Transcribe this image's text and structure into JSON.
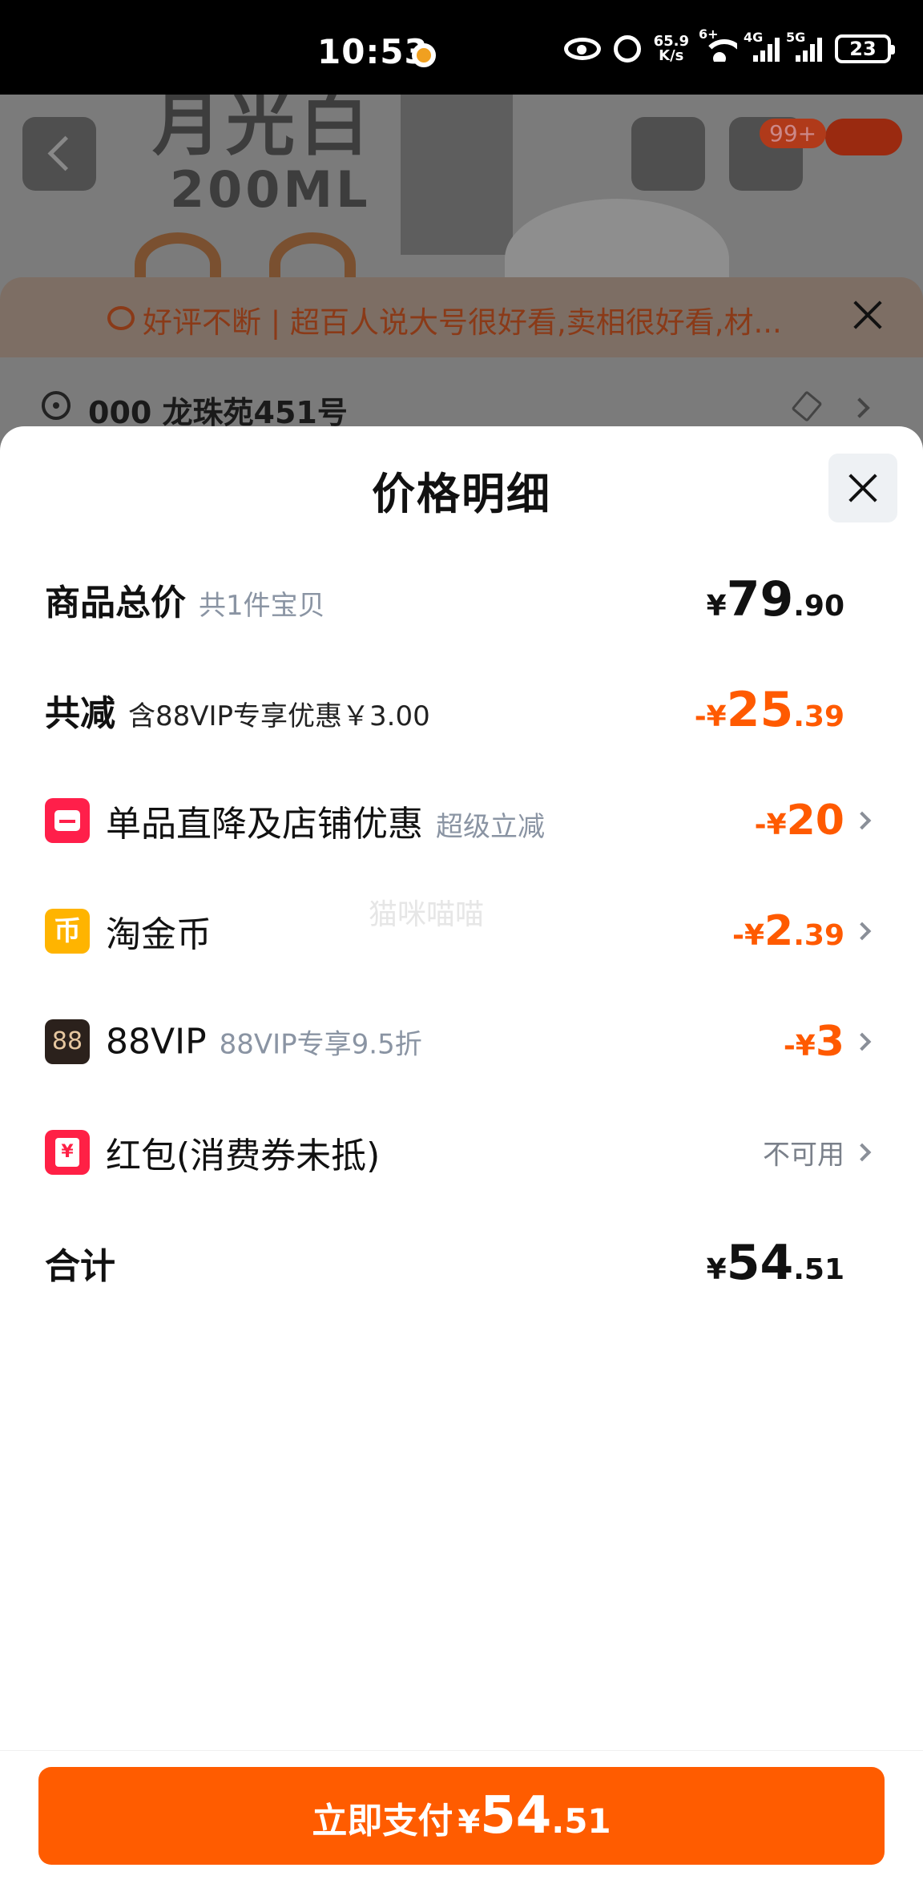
{
  "status_bar": {
    "time": "10:53",
    "net_speed": "65.9",
    "net_unit": "K/s",
    "wifi_badge": "6+",
    "sim1": "4G",
    "sim2": "5G",
    "battery": "23"
  },
  "background_page": {
    "product_line1": "月光白",
    "product_line2": "200ML",
    "cart_badge": "99+",
    "notice": "好评不断 | 超百人说大号很好看,卖相很好看,材...",
    "address": "000 龙珠苑451号"
  },
  "sheet": {
    "title": "价格明细",
    "rows": [
      {
        "label": "商品总价",
        "sub": "共1件宝贝",
        "currency": "¥",
        "int": "79",
        "dec": ".90"
      },
      {
        "label": "共减",
        "sub": "含88VIP专享优惠￥3.00",
        "prefix": "-¥",
        "int": "25",
        "dec": ".39"
      },
      {
        "label": "单品直降及店铺优惠",
        "sub": "超级立减",
        "prefix": "-¥",
        "int": "20",
        "dec": ""
      },
      {
        "label": "淘金币",
        "icon_char": "币",
        "prefix": "-¥",
        "int": "2",
        "dec": ".39"
      },
      {
        "label": "88VIP",
        "icon_char": "88",
        "sub": "88VIP专享9.5折",
        "prefix": "-¥",
        "int": "3",
        "dec": ""
      },
      {
        "label": "红包(消费券未抵)",
        "status": "不可用"
      },
      {
        "label": "合计",
        "currency": "¥",
        "int": "54",
        "dec": ".51"
      }
    ]
  },
  "watermark": "猫咪喵喵",
  "pay_button": {
    "label": "立即支付",
    "currency": "¥",
    "int": "54",
    "dec": ".51"
  },
  "colors": {
    "accent": "#ff5c00",
    "discount": "#ff5a00",
    "shop_icon": "#ff1f4a",
    "coin_icon": "#ffb400",
    "vip_icon": "#2b211c"
  },
  "icons": [
    "eye-icon",
    "alarm-icon",
    "wifi-icon",
    "signal-icon",
    "battery-icon",
    "back-icon",
    "share-icon",
    "cart-icon",
    "more-icon",
    "close-icon",
    "location-icon",
    "edit-icon",
    "chevron-right-icon",
    "shop-icon",
    "coin-icon",
    "vip-icon",
    "red-packet-icon"
  ]
}
